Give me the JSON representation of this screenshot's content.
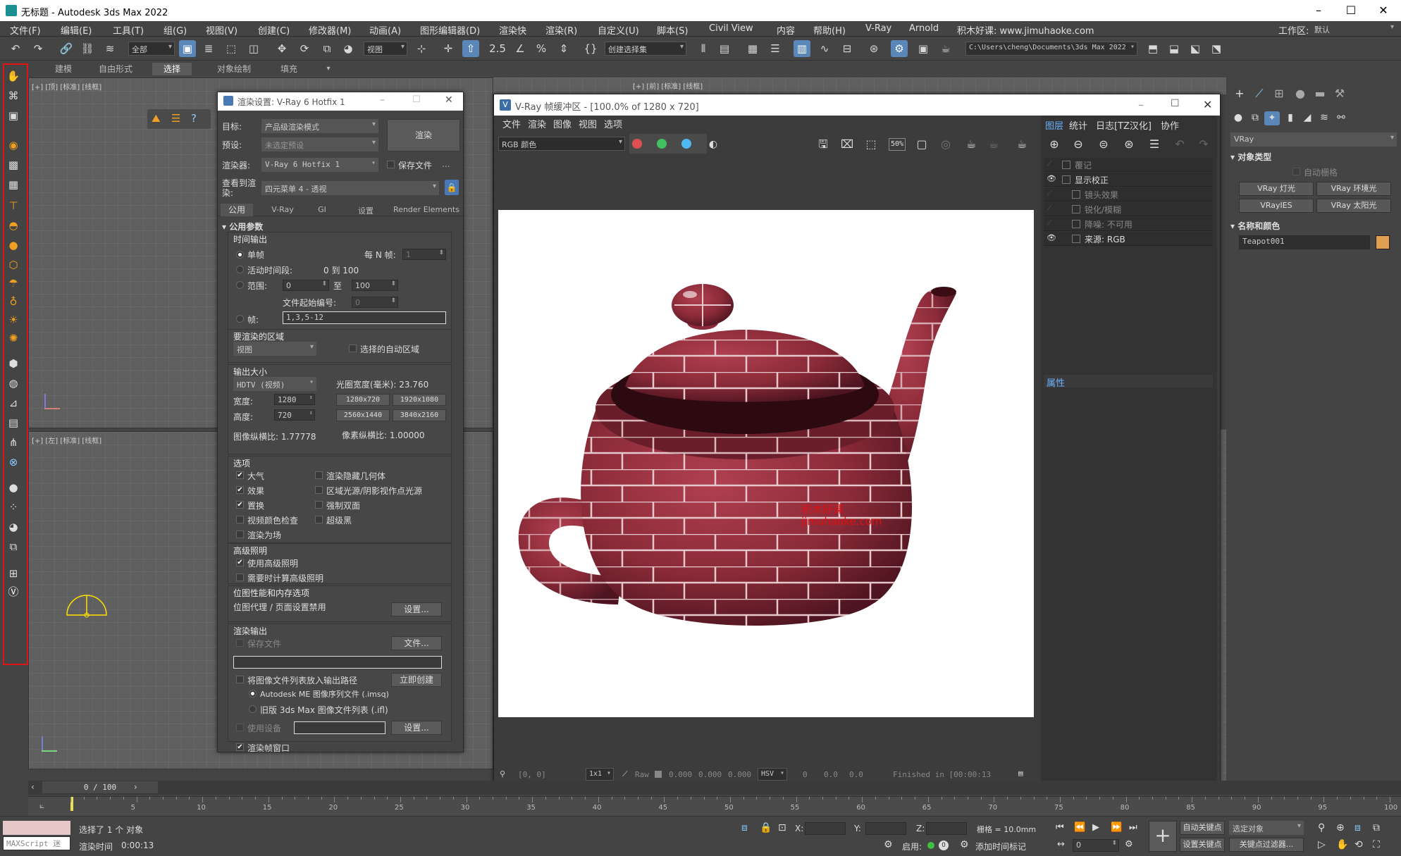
{
  "window": {
    "title": "无标题 - Autodesk 3ds Max 2022",
    "minimize_icon": "minimize-icon",
    "maximize_icon": "maximize-icon",
    "close_icon": "close-icon"
  },
  "menu": {
    "items": [
      "文件(F)",
      "编辑(E)",
      "工具(T)",
      "组(G)",
      "视图(V)",
      "创建(C)",
      "修改器(M)",
      "动画(A)",
      "图形编辑器(D)",
      "渲染快",
      "渲染(R)",
      "自定义(U)",
      "脚本(S)",
      "Civil View",
      "内容",
      "帮助(H)",
      "V-Ray",
      "Arnold",
      "积木好课: www.jimuhaoke.com"
    ],
    "workspace_label": "工作区:",
    "workspace_value": "默认"
  },
  "toolbar": {
    "filter_value": "全部",
    "view_value": "视图",
    "selection_set_placeholder": "创建选择集",
    "project_path": "C:\\Users\\cheng\\Documents\\3ds Max 2022"
  },
  "ribbon": {
    "tabs": [
      "建模",
      "自由形式",
      "选择",
      "对象绘制",
      "填充"
    ],
    "active_tab": "选择"
  },
  "viewports": {
    "top_left_label": "[+] [顶] [标准] [线框]",
    "bottom_left_label": "[+] [左] [标准] [线框]",
    "top_right_label": "[+] [前] [标准] [线框]"
  },
  "render_setup": {
    "title": "渲染设置: V-Ray 6 Hotfix 1",
    "target_label": "目标:",
    "target_value": "产品级渲染模式",
    "preset_label": "预设:",
    "preset_value": "未选定预设",
    "renderer_label": "渲染器:",
    "renderer_value": "V-Ray 6 Hotfix 1",
    "save_file_label": "保存文件",
    "view_label": "查看到渲染:",
    "view_value": "四元菜单 4 - 透视",
    "render_button": "渲染",
    "tabs": [
      "公用",
      "V-Ray",
      "GI",
      "设置",
      "Render Elements"
    ],
    "rollout_title": "公用参数",
    "time_output": {
      "title": "时间输出",
      "single": "单帧",
      "every_n": "每 N 帧:",
      "every_n_value": "1",
      "active_segment": "活动时间段:",
      "active_range": "0 到 100",
      "range": "范围:",
      "range_from": "0",
      "range_to_label": "至",
      "range_to": "100",
      "file_start": "文件起始编号:",
      "file_start_value": "0",
      "frames": "帧:",
      "frames_value": "1,3,5-12"
    },
    "area": {
      "title": "要渲染的区域",
      "value": "视图",
      "auto_region": "选择的自动区域"
    },
    "output_size": {
      "title": "输出大小",
      "preset": "HDTV (视频)",
      "aperture": "光圈宽度(毫米): 23.760",
      "width_label": "宽度:",
      "width": "1280",
      "height_label": "高度:",
      "height": "720",
      "presets": [
        "1280x720",
        "1920x1080",
        "2560x1440",
        "3840x2160"
      ],
      "image_aspect": "图像纵横比: 1.77778",
      "pixel_aspect": "像素纵横比: 1.00000"
    },
    "options": {
      "title": "选项",
      "left": [
        {
          "label": "大气",
          "checked": true
        },
        {
          "label": "效果",
          "checked": true
        },
        {
          "label": "置换",
          "checked": true
        },
        {
          "label": "视频颜色检查",
          "checked": false
        },
        {
          "label": "渲染为场",
          "checked": false
        }
      ],
      "right": [
        {
          "label": "渲染隐藏几何体",
          "checked": false
        },
        {
          "label": "区域光源/阴影视作点光源",
          "checked": false
        },
        {
          "label": "强制双面",
          "checked": false
        },
        {
          "label": "超级黑",
          "checked": false
        }
      ]
    },
    "advanced_lighting": {
      "title": "高级照明",
      "use": "使用高级照明",
      "compute": "需要时计算高级照明"
    },
    "bitmap": {
      "title": "位图性能和内存选项",
      "proxy": "位图代理 / 页面设置禁用",
      "setup": "设置..."
    },
    "render_output": {
      "title": "渲染输出",
      "save_file": "保存文件",
      "files_button": "文件...",
      "put_list": "将图像文件列表放入输出路径",
      "create_now": "立即创建",
      "imsq": "Autodesk ME 图像序列文件 (.imsq)",
      "ifl": "旧版 3ds Max 图像文件列表 (.ifl)",
      "use_device": "使用设备",
      "device_setup": "设置...",
      "frame_window": "渲染帧窗口"
    }
  },
  "vfb": {
    "title": "V-Ray 帧缓冲区 - [100.0% of 1280 x 720]",
    "menu": [
      "文件",
      "渲染",
      "图像",
      "视图",
      "选项"
    ],
    "channel": "RGB 颜色",
    "zoom_text": "50%",
    "watermark_line1": "积木好课",
    "watermark_line2": "jimuhaoke.com",
    "layers_tabs": [
      "图层",
      "统计",
      "日志[TZ汉化]",
      "协作"
    ],
    "layers": [
      {
        "label": "覆记",
        "eye": false,
        "indent": 0
      },
      {
        "label": "显示校正",
        "eye": true,
        "indent": 0
      },
      {
        "label": "镜头效果",
        "eye": false,
        "indent": 1
      },
      {
        "label": "锐化/模糊",
        "eye": false,
        "indent": 1
      },
      {
        "label": "降噪: 不可用",
        "eye": false,
        "indent": 1
      },
      {
        "label": "来源: RGB",
        "eye": true,
        "indent": 1
      }
    ],
    "properties_title": "属性",
    "status": {
      "coords": "[0, 0]",
      "scale": "1x1",
      "raw": "Raw",
      "r": "0.000",
      "g": "0.000",
      "b": "0.000",
      "mode": "HSV",
      "h": "0",
      "s": "0.0",
      "v": "0.0",
      "finished": "Finished in [00:00:13"
    },
    "colors": {
      "red": "#e05050",
      "green": "#40c060",
      "blue": "#50b8f0",
      "teapot": "#8a2a38"
    }
  },
  "command_panel": {
    "renderer_dropdown": "VRay",
    "object_type_title": "对象类型",
    "auto_grid": "自动栅格",
    "buttons": [
      "VRay 灯光",
      "VRay 环境光",
      "VRayIES",
      "VRay 太阳光"
    ],
    "name_color_title": "名称和颜色",
    "object_name": "Teapot001",
    "object_color": "#e0a050"
  },
  "timeline": {
    "frame": "0 / 100",
    "ticks": [
      "5",
      "10",
      "15",
      "20",
      "25",
      "30",
      "35",
      "40",
      "45",
      "50",
      "55",
      "60",
      "65",
      "70",
      "75",
      "80",
      "85",
      "90",
      "95",
      "100"
    ]
  },
  "status_bar": {
    "maxscript": "MAXScript 迷",
    "selected": "选择了 1 个 对象",
    "render_time_label": "渲染时间",
    "render_time": "0:00:13",
    "x_label": "X:",
    "y_label": "Y:",
    "z_label": "Z:",
    "grid": "栅格 = 10.0mm",
    "enable": "启用:",
    "add_time_tag": "添加时间标记",
    "auto_key": "自动关键点",
    "set_key": "设置关键点",
    "selected_object": "选定对象",
    "key_filters": "关键点过滤器...",
    "frame_value": "0"
  }
}
